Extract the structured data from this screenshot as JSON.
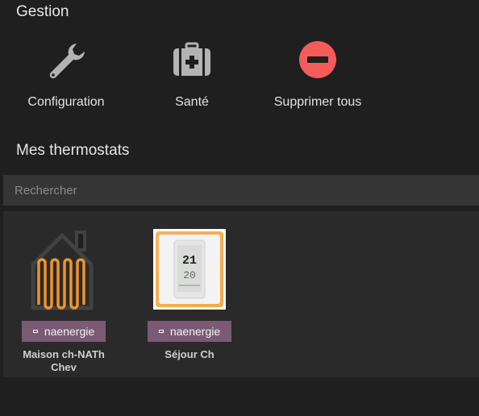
{
  "gestion": {
    "title": "Gestion",
    "tools": [
      {
        "label": "Configuration",
        "icon": "wrench-icon"
      },
      {
        "label": "Santé",
        "icon": "medical-kit-icon"
      },
      {
        "label": "Supprimer tous",
        "icon": "minus-circle-icon"
      }
    ]
  },
  "thermostats": {
    "title": "Mes thermostats",
    "search_placeholder": "Rechercher",
    "devices": [
      {
        "name": "Maison ch-NATh Chev",
        "plugin": "naenergie",
        "icon": "house-heating-icon"
      },
      {
        "name": "Séjour Ch",
        "plugin": "naenergie",
        "icon": "thermostat-icon",
        "display_temp": "21",
        "display_set": "20"
      }
    ]
  },
  "colors": {
    "background": "#1f1f1f",
    "panel": "#2a2a2a",
    "icon_gray": "#b3b3b3",
    "danger": "#f45b5b",
    "badge": "#7b5a74",
    "heating_orange": "#f0932b"
  }
}
